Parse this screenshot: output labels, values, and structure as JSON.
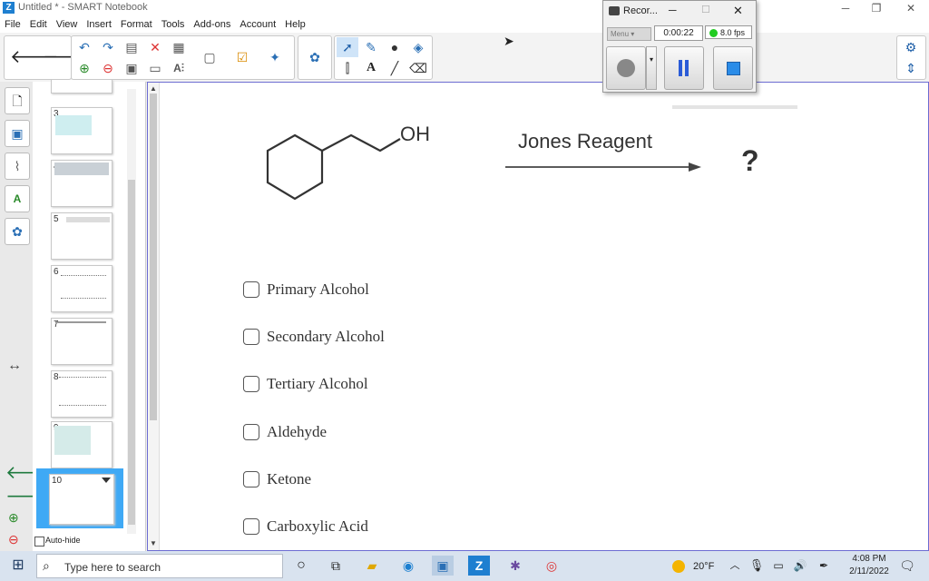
{
  "window": {
    "title": "Untitled * - SMART Notebook"
  },
  "menu": [
    "File",
    "Edit",
    "View",
    "Insert",
    "Format",
    "Tools",
    "Add-ons",
    "Account",
    "Help"
  ],
  "sorter": {
    "pages": [
      "3",
      "4",
      "5",
      "6",
      "7",
      "8",
      "9",
      "10"
    ],
    "autohide_label": "Auto-hide"
  },
  "canvas": {
    "reagent": "Jones Reagent",
    "oh_label": "OH",
    "question_mark": "?",
    "options": [
      "Primary Alcohol",
      "Secondary Alcohol",
      "Tertiary Alcohol",
      "Aldehyde",
      "Ketone",
      "Carboxylic Acid"
    ]
  },
  "recorder": {
    "title": "Recor...",
    "menu_label": "Menu",
    "time": "0:00:22",
    "fps": "8.0 fps"
  },
  "taskbar": {
    "search_placeholder": "Type here to search",
    "weather": "20°F",
    "time": "4:08 PM",
    "date": "2/11/2022"
  },
  "colors": {
    "accent": "#1e7fd0",
    "canvas_border": "#6c6cd2",
    "record_green": "#22cc22",
    "selected_thumb": "#3fa9f5"
  }
}
